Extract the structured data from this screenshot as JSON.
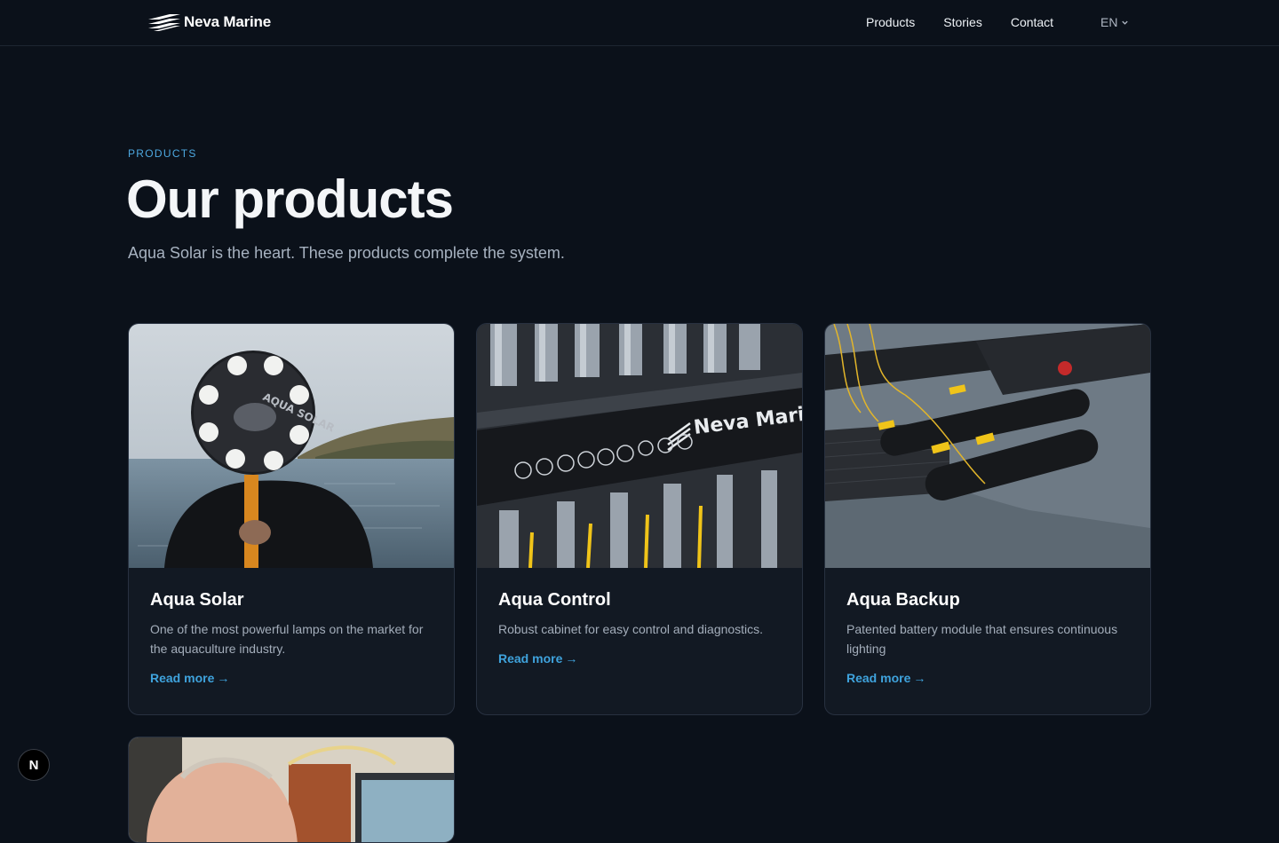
{
  "header": {
    "brand": "Neva Marine",
    "nav": [
      "Products",
      "Stories",
      "Contact"
    ],
    "language": "EN"
  },
  "hero": {
    "eyebrow": "PRODUCTS",
    "title": "Our products",
    "subtitle": "Aqua Solar is the heart. These products complete the system."
  },
  "products": [
    {
      "title": "Aqua Solar",
      "description": "One of the most powerful lamps on the market for the aquaculture industry.",
      "link": "Read more",
      "image_text": "AQUA SOLAR"
    },
    {
      "title": "Aqua Control",
      "description": "Robust cabinet for easy control and diagnostics.",
      "link": "Read more",
      "image_text": "Neva Marine"
    },
    {
      "title": "Aqua Backup",
      "description": "Patented battery module that ensures continuous lighting",
      "link": "Read more"
    }
  ],
  "link_arrow": "→",
  "dev_badge": "N",
  "colors": {
    "background": "#0b111a",
    "accent": "#3fa3dd",
    "card": "#121923"
  }
}
